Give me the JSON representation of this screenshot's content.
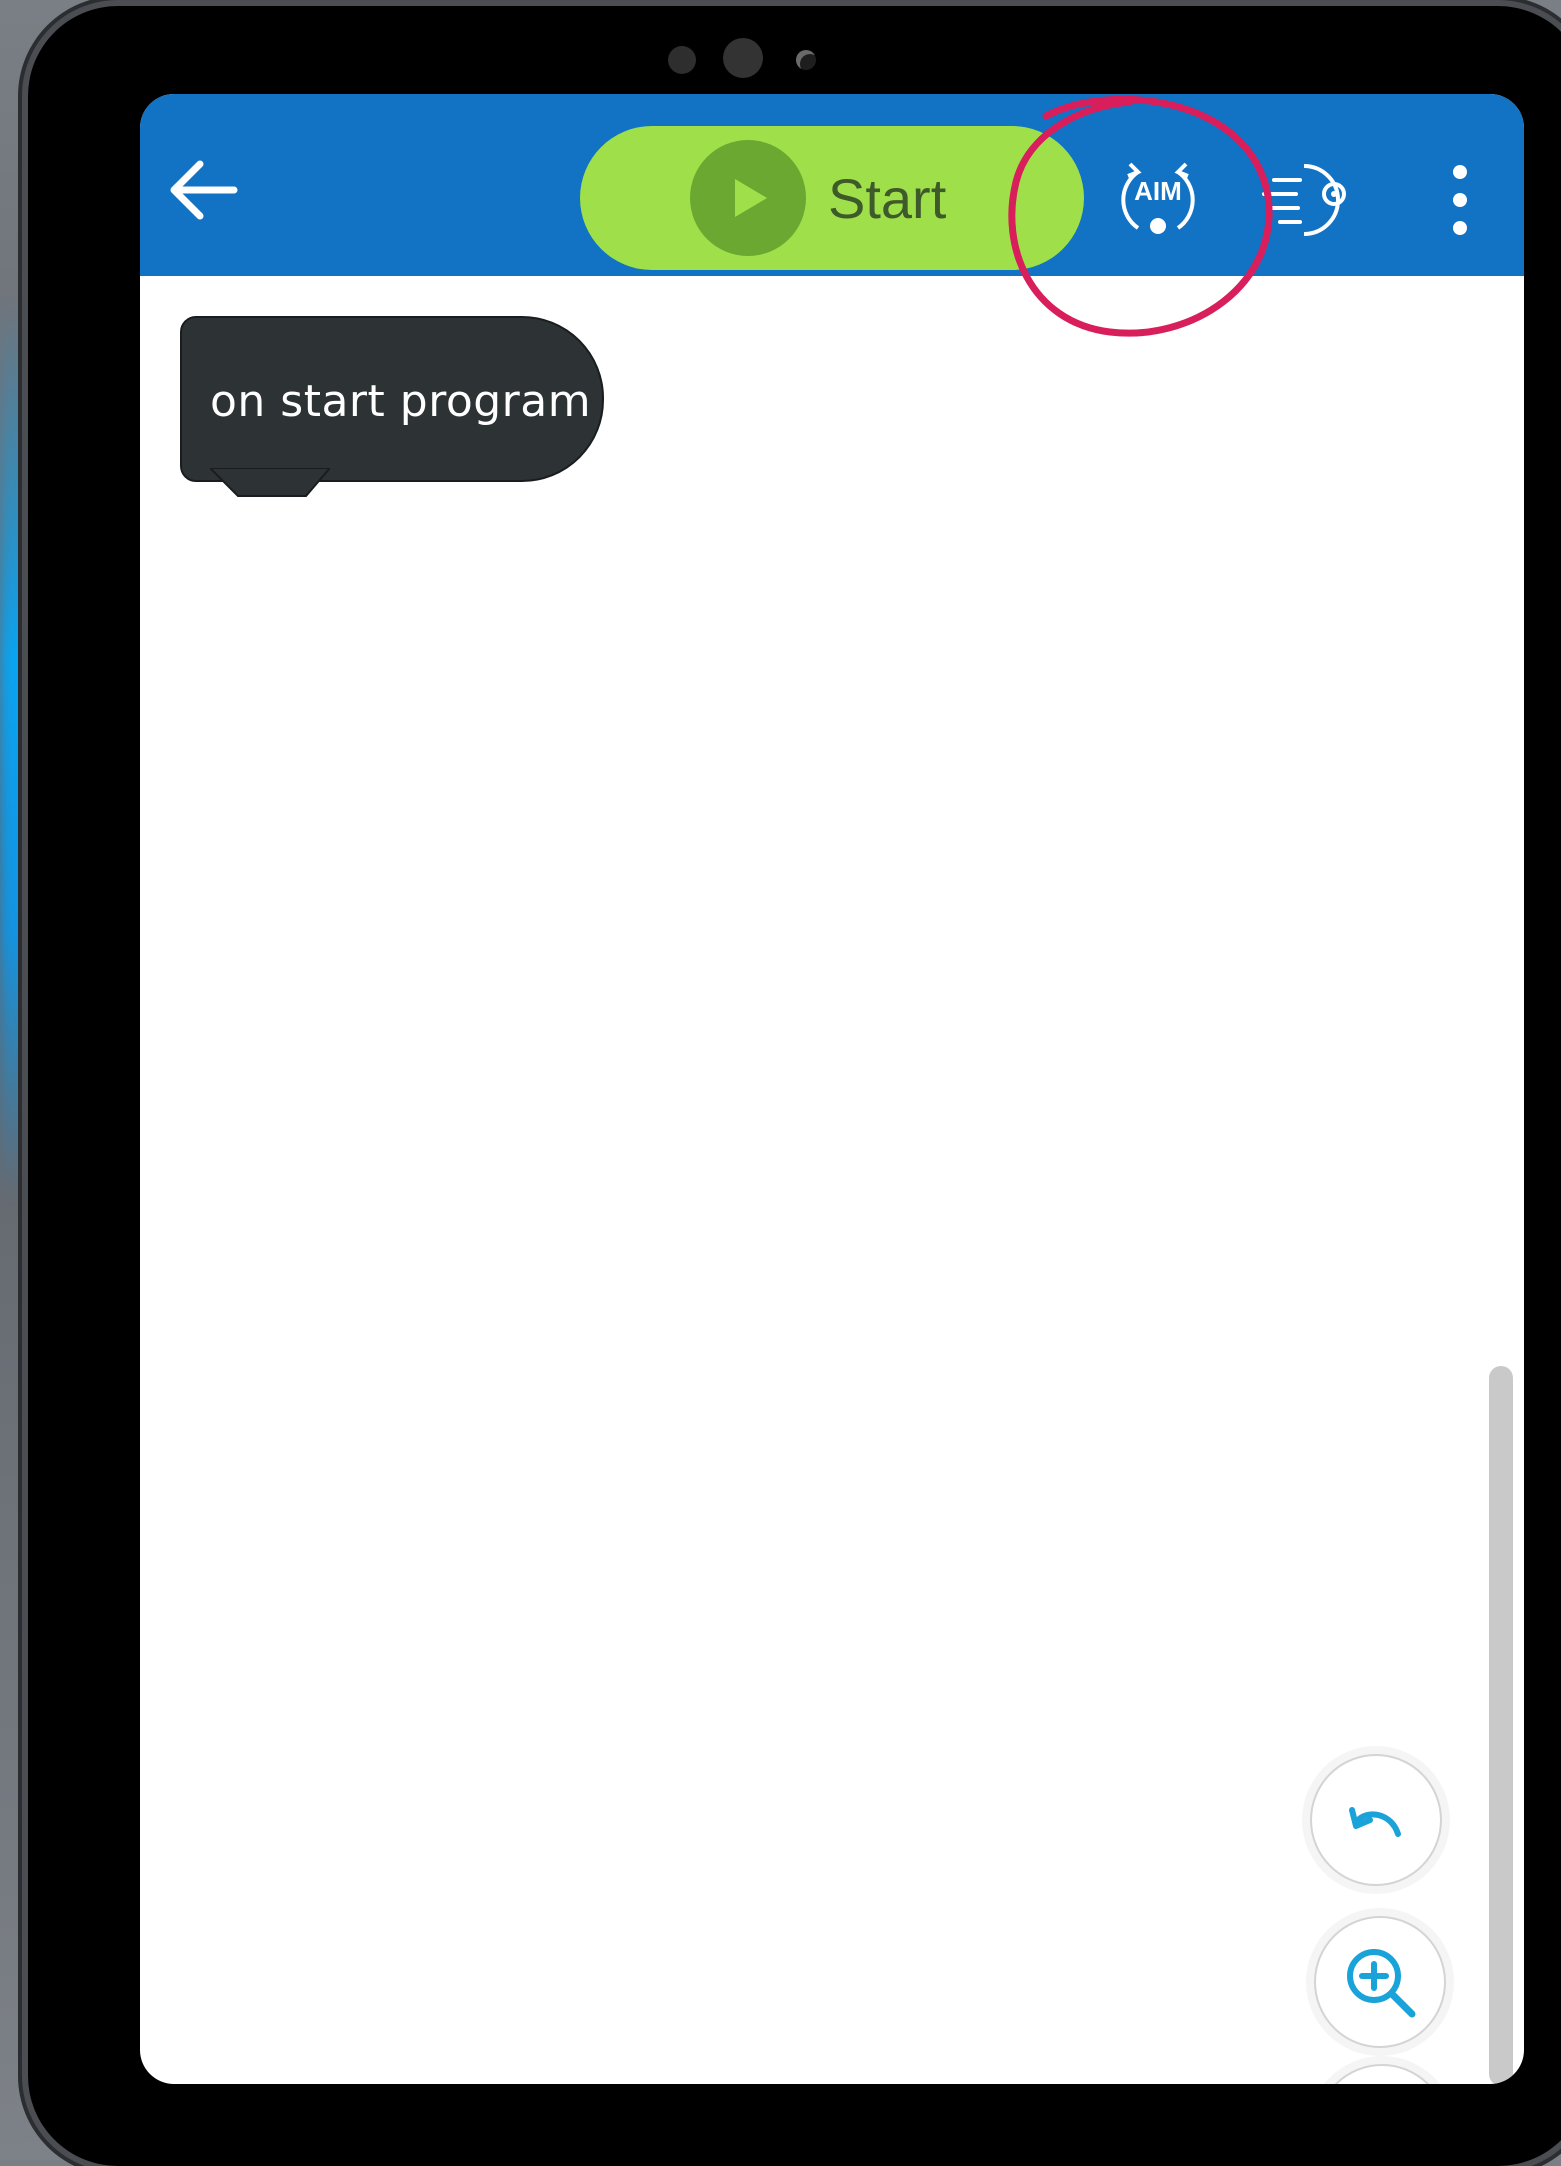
{
  "toolbar": {
    "back_icon": "arrow-left-icon",
    "start_label": "Start",
    "start_icon": "play-icon",
    "aim_label": "AIM",
    "robot_icon": "robot-drive-icon",
    "menu_icon": "more-vertical-icon"
  },
  "canvas": {
    "block_label": "on start program"
  },
  "controls": {
    "undo_icon": "undo-icon",
    "zoom_in_icon": "zoom-in-icon"
  },
  "colors": {
    "toolbar_bg": "#1272c4",
    "start_button_bg": "#9fe04a",
    "start_circle_bg": "#6aa832",
    "block_bg": "#2d3235",
    "annotation": "#d81e5b",
    "accent": "#1aa3d9"
  }
}
